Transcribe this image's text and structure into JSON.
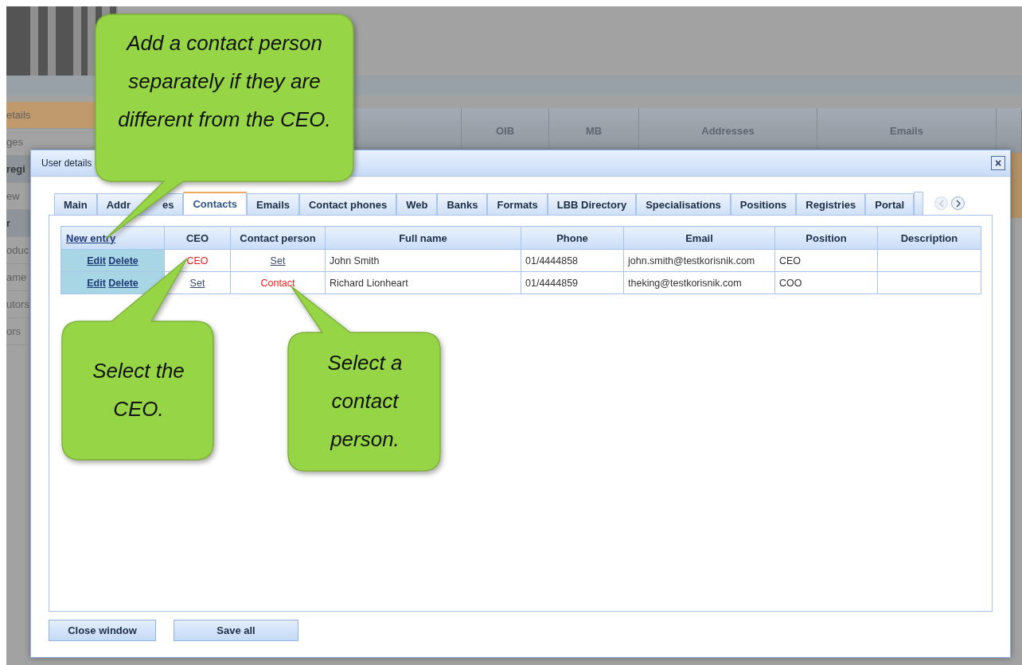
{
  "backdrop": {
    "sidebar": [
      {
        "label": "etails",
        "kind": "item",
        "selected": true
      },
      {
        "label": "ges",
        "kind": "item",
        "selected": false
      },
      {
        "label": "regi",
        "kind": "header",
        "selected": false
      },
      {
        "label": "ew",
        "kind": "item",
        "selected": false
      },
      {
        "label": "r",
        "kind": "header",
        "selected": false
      },
      {
        "label": "oduc",
        "kind": "item",
        "selected": false
      },
      {
        "label": "ame",
        "kind": "item",
        "selected": false
      },
      {
        "label": "utors",
        "kind": "item",
        "selected": false
      },
      {
        "label": "ors",
        "kind": "item",
        "selected": false
      }
    ],
    "columns": [
      "OIB",
      "MB",
      "Addresses",
      "Emails"
    ]
  },
  "dialog": {
    "title": "User details",
    "close": "×",
    "tabs": [
      {
        "label": "Main",
        "selected": false
      },
      {
        "label": "Addr",
        "label_end": "es",
        "selected": false
      },
      {
        "label": "Contacts",
        "selected": true
      },
      {
        "label": "Emails",
        "selected": false
      },
      {
        "label": "Contact phones",
        "selected": false
      },
      {
        "label": "Web",
        "selected": false
      },
      {
        "label": "Banks",
        "selected": false
      },
      {
        "label": "Formats",
        "selected": false
      },
      {
        "label": "LBB Directory",
        "selected": false
      },
      {
        "label": "Specialisations",
        "selected": false
      },
      {
        "label": "Positions",
        "selected": false
      },
      {
        "label": "Registries",
        "selected": false
      },
      {
        "label": "Portal",
        "selected": false
      }
    ],
    "table": {
      "new_entry": "New entry",
      "columns": [
        "CEO",
        "Contact person",
        "Full name",
        "Phone",
        "Email",
        "Position",
        "Description"
      ],
      "rows": [
        {
          "edit": "Edit",
          "delete": "Delete",
          "ceo": {
            "label": "CEO",
            "selected": true
          },
          "contact": {
            "label": "Set",
            "selected": false
          },
          "full_name": "John Smith",
          "phone": "01/4444858",
          "email": "john.smith@testkorisnik.com",
          "position": "CEO"
        },
        {
          "edit": "Edit",
          "delete": "Delete",
          "ceo": {
            "label": "Set",
            "selected": false
          },
          "contact": {
            "label": "Contact",
            "selected": true
          },
          "full_name": "Richard Lionheart",
          "phone": "01/4444859",
          "email": "theking@testkorisnik.com",
          "position": "COO"
        }
      ]
    },
    "buttons": [
      "Close window",
      "Save all"
    ]
  },
  "callouts": [
    {
      "text": "Add a contact person separately if they are different from the CEO."
    },
    {
      "text": "Select the CEO."
    },
    {
      "text": "Select a contact person."
    }
  ]
}
